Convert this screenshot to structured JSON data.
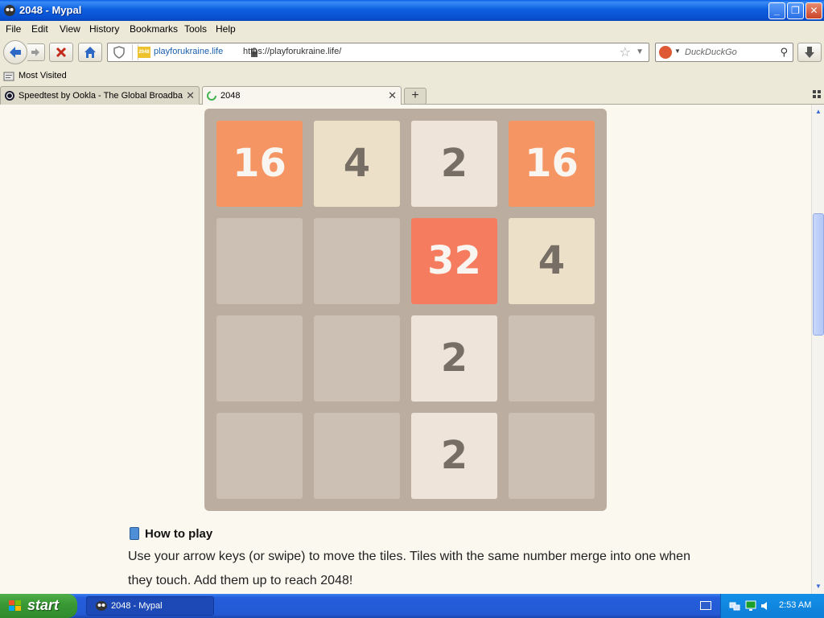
{
  "window": {
    "title": "2048 - Mypal"
  },
  "menu": [
    "File",
    "Edit",
    "View",
    "History",
    "Bookmarks",
    "Tools",
    "Help"
  ],
  "urlbar": {
    "domain": "playforukraine.life",
    "url": "https://playforukraine.life/",
    "favicon_text": "2048"
  },
  "search": {
    "placeholder": "DuckDuckGo"
  },
  "bookmarks": {
    "most_visited": "Most Visited"
  },
  "tabs": [
    {
      "label": "Speedtest by Ookla - The Global Broadba..."
    },
    {
      "label": "2048"
    }
  ],
  "game": {
    "tiles": [
      [
        16,
        4,
        2,
        16
      ],
      [
        null,
        null,
        32,
        4
      ],
      [
        null,
        null,
        2,
        null
      ],
      [
        null,
        null,
        2,
        null
      ]
    ],
    "colors": {
      "board": "#bbada0",
      "tile_2": "#eee4da",
      "tile_4": "#ede0c8",
      "tile_16": "#f59563",
      "tile_32": "#f67c5f",
      "dark_text": "#776e65",
      "light_text": "#f9f6f2"
    }
  },
  "howto": {
    "heading": "How to play",
    "text": "Use your arrow keys (or swipe) to move the tiles. Tiles with the same number merge into one when they touch. Add them up to reach 2048!"
  },
  "taskbar": {
    "start": "start",
    "task": "2048 - Mypal",
    "clock": "2:53 AM"
  }
}
